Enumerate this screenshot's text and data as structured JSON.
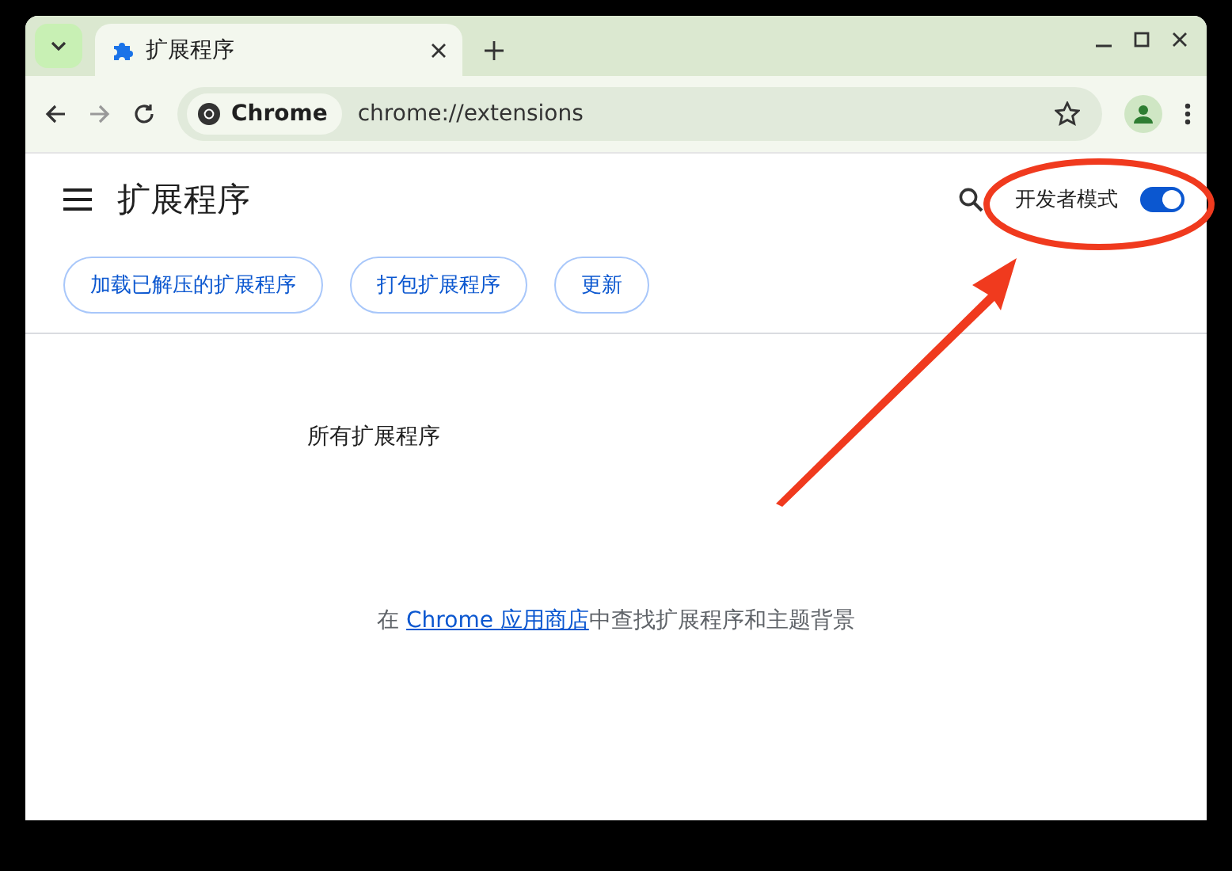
{
  "window": {
    "tabs": [
      {
        "title": "扩展程序",
        "selected": true
      }
    ]
  },
  "toolbar": {
    "chip": "Chrome",
    "url": "chrome://extensions"
  },
  "page": {
    "title": "扩展程序",
    "dev_mode": {
      "label": "开发者模式",
      "on": true
    },
    "buttons": [
      "加载已解压的扩展程序",
      "打包扩展程序",
      "更新"
    ],
    "section": "所有扩展程序",
    "footer": {
      "before": "在 ",
      "link": "Chrome 应用商店",
      "after": "中查找扩展程序和主题背景"
    }
  }
}
